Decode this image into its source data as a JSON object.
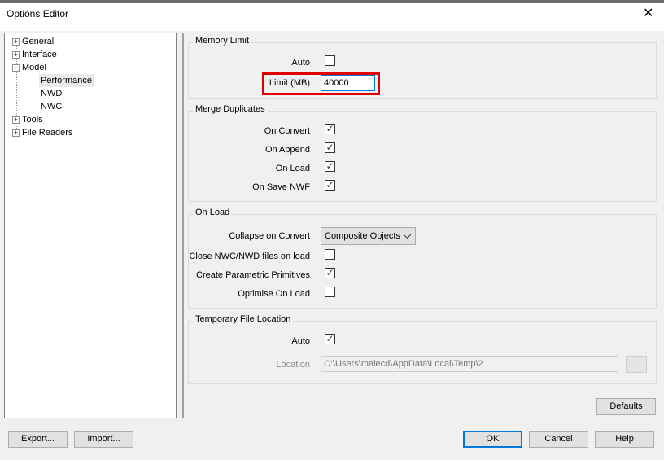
{
  "window": {
    "title": "Options Editor",
    "close": "✕"
  },
  "tree": [
    {
      "label": "General",
      "expander": "+"
    },
    {
      "label": "Interface",
      "expander": "+"
    },
    {
      "label": "Model",
      "expander": "−"
    },
    {
      "label": "Performance"
    },
    {
      "label": "NWD"
    },
    {
      "label": "NWC"
    },
    {
      "label": "Tools",
      "expander": "+"
    },
    {
      "label": "File Readers",
      "expander": "+"
    }
  ],
  "memory": {
    "title": "Memory Limit",
    "auto_label": "Auto",
    "auto_checked": false,
    "limit_label": "Limit (MB)",
    "limit_value": "40000"
  },
  "merge": {
    "title": "Merge Duplicates",
    "items": [
      {
        "label": "On Convert",
        "checked": true
      },
      {
        "label": "On Append",
        "checked": true
      },
      {
        "label": "On Load",
        "checked": true
      },
      {
        "label": "On Save NWF",
        "checked": true
      }
    ]
  },
  "onload": {
    "title": "On Load",
    "collapse_label": "Collapse on Convert",
    "collapse_value": "Composite Objects",
    "close_label": "Close NWC/NWD files on load",
    "close_checked": false,
    "param_label": "Create Parametric Primitives",
    "param_checked": true,
    "optimise_label": "Optimise On Load",
    "optimise_checked": false
  },
  "temp": {
    "title": "Temporary File Location",
    "auto_label": "Auto",
    "auto_checked": true,
    "location_label": "Location",
    "location_value": "C:\\Users\\malecd\\AppData\\Local\\Temp\\2",
    "browse": "..."
  },
  "buttons": {
    "defaults": "Defaults",
    "export": "Export...",
    "import": "Import...",
    "ok": "OK",
    "cancel": "Cancel",
    "help": "Help"
  },
  "check_glyph": "✓",
  "highlight_color": "#e00000"
}
